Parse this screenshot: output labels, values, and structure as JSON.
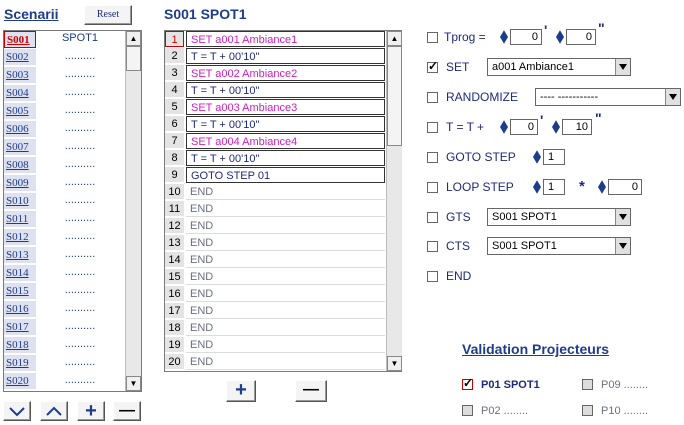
{
  "scenarii": {
    "title": "Scenarii",
    "reset_label": "Reset",
    "rows": [
      {
        "code": "S001",
        "name": "SPOT1",
        "selected": true
      },
      {
        "code": "S002",
        "name": "..........",
        "selected": false
      },
      {
        "code": "S003",
        "name": "..........",
        "selected": false
      },
      {
        "code": "S004",
        "name": "..........",
        "selected": false
      },
      {
        "code": "S005",
        "name": "..........",
        "selected": false
      },
      {
        "code": "S006",
        "name": "..........",
        "selected": false
      },
      {
        "code": "S007",
        "name": "..........",
        "selected": false
      },
      {
        "code": "S008",
        "name": "..........",
        "selected": false
      },
      {
        "code": "S009",
        "name": "..........",
        "selected": false
      },
      {
        "code": "S010",
        "name": "..........",
        "selected": false
      },
      {
        "code": "S011",
        "name": "..........",
        "selected": false
      },
      {
        "code": "S012",
        "name": "..........",
        "selected": false
      },
      {
        "code": "S013",
        "name": "..........",
        "selected": false
      },
      {
        "code": "S014",
        "name": "..........",
        "selected": false
      },
      {
        "code": "S015",
        "name": "..........",
        "selected": false
      },
      {
        "code": "S016",
        "name": "..........",
        "selected": false
      },
      {
        "code": "S017",
        "name": "..........",
        "selected": false
      },
      {
        "code": "S018",
        "name": "..........",
        "selected": false
      },
      {
        "code": "S019",
        "name": "..........",
        "selected": false
      },
      {
        "code": "S020",
        "name": "..........",
        "selected": false
      }
    ],
    "buttons": {
      "down": "﹀",
      "up": "︿",
      "add": "+",
      "remove": "—"
    }
  },
  "steps": {
    "title": "S001 SPOT1",
    "rows": [
      {
        "num": "1",
        "text": "SET a001  Ambiance1",
        "color": "pink",
        "selected": true
      },
      {
        "num": "2",
        "text": "T = T + 00'10\"",
        "color": "navy",
        "selected": false
      },
      {
        "num": "3",
        "text": "SET a002  Ambiance2",
        "color": "pink",
        "selected": false
      },
      {
        "num": "4",
        "text": "T = T + 00'10\"",
        "color": "navy",
        "selected": false
      },
      {
        "num": "5",
        "text": "SET a003  Ambiance3",
        "color": "pink",
        "selected": false
      },
      {
        "num": "6",
        "text": "T = T + 00'10\"",
        "color": "navy",
        "selected": false
      },
      {
        "num": "7",
        "text": "SET a004  Ambiance4",
        "color": "pink",
        "selected": false
      },
      {
        "num": "8",
        "text": "T = T + 00'10\"",
        "color": "navy",
        "selected": false
      },
      {
        "num": "9",
        "text": "GOTO STEP 01",
        "color": "navy",
        "selected": false
      },
      {
        "num": "10",
        "text": "END",
        "color": "grey",
        "selected": false
      },
      {
        "num": "11",
        "text": "END",
        "color": "grey",
        "selected": false
      },
      {
        "num": "12",
        "text": "END",
        "color": "grey",
        "selected": false
      },
      {
        "num": "13",
        "text": "END",
        "color": "grey",
        "selected": false
      },
      {
        "num": "14",
        "text": "END",
        "color": "grey",
        "selected": false
      },
      {
        "num": "15",
        "text": "END",
        "color": "grey",
        "selected": false
      },
      {
        "num": "16",
        "text": "END",
        "color": "grey",
        "selected": false
      },
      {
        "num": "17",
        "text": "END",
        "color": "grey",
        "selected": false
      },
      {
        "num": "18",
        "text": "END",
        "color": "grey",
        "selected": false
      },
      {
        "num": "19",
        "text": "END",
        "color": "grey",
        "selected": false
      },
      {
        "num": "20",
        "text": "END",
        "color": "grey",
        "selected": false
      }
    ],
    "add_label": "+",
    "remove_label": "—"
  },
  "controls": {
    "tprog": {
      "label": "Tprog =",
      "min": "0",
      "sec": "0",
      "checked": false,
      "min_unit": "'",
      "sec_unit": "\""
    },
    "set": {
      "label": "SET",
      "value": "a001 Ambiance1",
      "checked": true
    },
    "randomize": {
      "label": "RANDOMIZE",
      "value": "---- -----------",
      "checked": false
    },
    "tt": {
      "label": "T = T +",
      "min": "0",
      "sec": "10",
      "checked": false,
      "min_unit": "'",
      "sec_unit": "\""
    },
    "goto": {
      "label": "GOTO STEP",
      "value": "1",
      "checked": false
    },
    "loop": {
      "label": "LOOP STEP",
      "step": "1",
      "times": "0",
      "mult": "*",
      "checked": false
    },
    "gts": {
      "label": "GTS",
      "value": "S001 SPOT1",
      "checked": false
    },
    "cts": {
      "label": "CTS",
      "value": "S001 SPOT1",
      "checked": false
    },
    "end": {
      "label": "END",
      "checked": false
    }
  },
  "validation": {
    "title": "Validation Projecteurs",
    "items": [
      {
        "label": "P01 SPOT1",
        "checked": true
      },
      {
        "label": "P09 ........",
        "checked": false
      },
      {
        "label": "P02 ........",
        "checked": false
      },
      {
        "label": "P10 ........",
        "checked": false
      }
    ]
  }
}
